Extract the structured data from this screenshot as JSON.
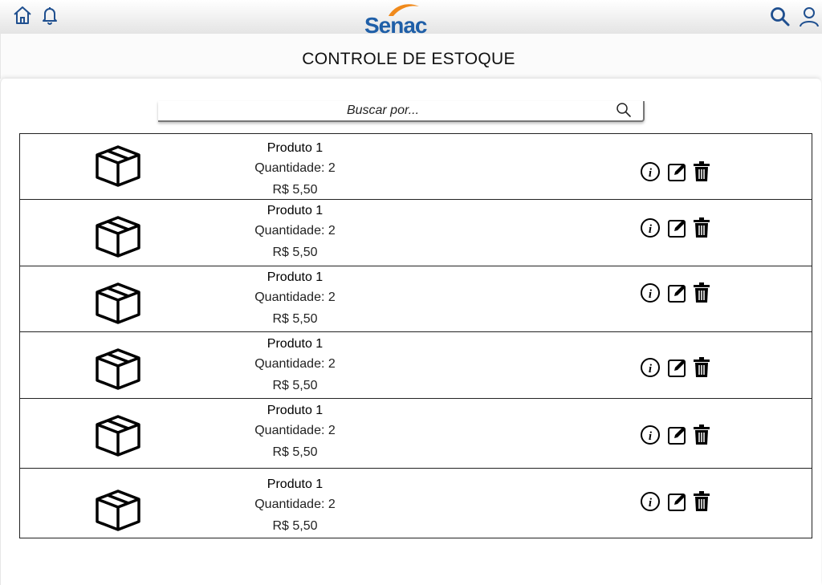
{
  "header": {
    "logo_text": "Senac",
    "brand_colors": {
      "logo_blue": "#1f5fa8",
      "logo_orange": "#f08a1c"
    },
    "icons": [
      "home-icon",
      "bell-icon",
      "search-icon",
      "user-icon"
    ]
  },
  "page": {
    "title": "CONTROLE DE ESTOQUE"
  },
  "search": {
    "placeholder": "Buscar por...",
    "value": ""
  },
  "products": [
    {
      "name": "Produto 1",
      "quantity": "Quantidade: 2",
      "price": "R$ 5,50"
    },
    {
      "name": "Produto 1",
      "quantity": "Quantidade: 2",
      "price": "R$ 5,50"
    },
    {
      "name": "Produto 1",
      "quantity": "Quantidade: 2",
      "price": "R$ 5,50"
    },
    {
      "name": "Produto 1",
      "quantity": "Quantidade: 2",
      "price": "R$ 5,50"
    },
    {
      "name": "Produto 1",
      "quantity": "Quantidade: 2",
      "price": "R$ 5,50"
    },
    {
      "name": "Produto 1",
      "quantity": "Quantidade: 2",
      "price": "R$ 5,50"
    }
  ],
  "row_actions": [
    "info-icon",
    "edit-icon",
    "trash-icon"
  ]
}
